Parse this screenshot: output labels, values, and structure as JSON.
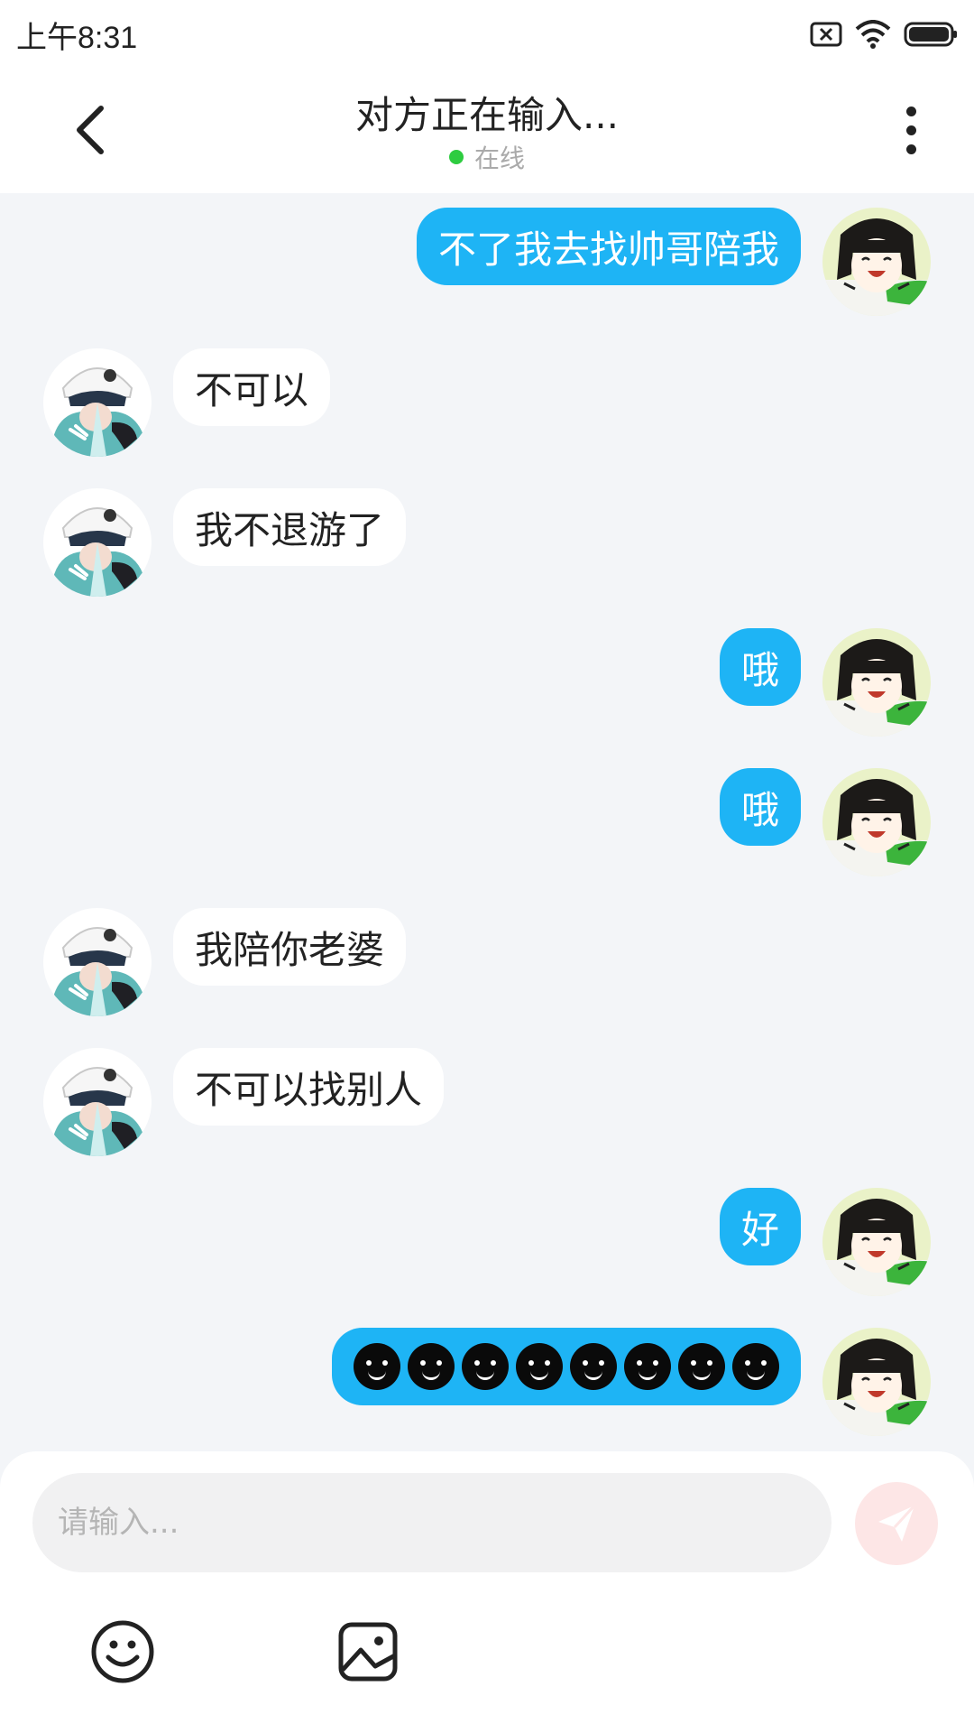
{
  "status_bar": {
    "time": "上午8:31"
  },
  "header": {
    "title": "对方正在输入...",
    "online_status": "在线",
    "online_color": "#2ecc40"
  },
  "colors": {
    "my_bubble": "#1eb4f5",
    "other_bubble": "#ffffff",
    "background": "#f3f5f8"
  },
  "messages": [
    {
      "sender": "me",
      "text": "不了我去找帅哥陪我"
    },
    {
      "sender": "other",
      "text": "不可以"
    },
    {
      "sender": "other",
      "text": "我不退游了"
    },
    {
      "sender": "me",
      "text": "哦"
    },
    {
      "sender": "me",
      "text": "哦"
    },
    {
      "sender": "other",
      "text": "我陪你老婆"
    },
    {
      "sender": "other",
      "text": "不可以找别人"
    },
    {
      "sender": "me",
      "text": "好"
    },
    {
      "sender": "me",
      "emoji_count": 8,
      "emoji": "dark-face-emoji"
    }
  ],
  "composer": {
    "placeholder": "请输入...",
    "send_icon": "paper-plane-icon",
    "emoji_icon": "smiley-icon",
    "image_icon": "image-icon"
  }
}
